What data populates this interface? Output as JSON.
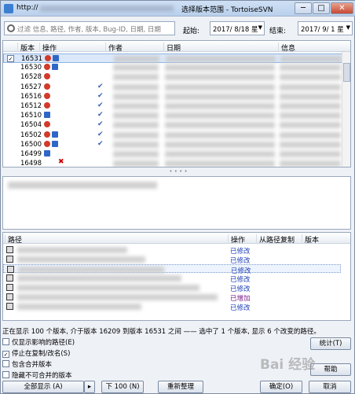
{
  "window": {
    "url_prefix": "http://",
    "title": "选择版本范围 - TortoiseSVN",
    "minimize": "─",
    "maximize": "□",
    "close": "✕"
  },
  "filter": {
    "placeholder": "过滤 信息, 路径, 作者, 版本, Bug-ID, 日期, 日期",
    "from_label": "起始:",
    "from_value": "2017/ 8/18 星",
    "to_label": "结束:",
    "to_value": "2017/ 9/ 1 星"
  },
  "log_columns": {
    "revision": "版本",
    "actions": "操作",
    "author": "作者",
    "date": "日期",
    "message": "信息"
  },
  "revisions": [
    "16531",
    "16530",
    "16528",
    "16527",
    "16516",
    "16512",
    "16510",
    "16504",
    "16502",
    "16500",
    "16499",
    "16498"
  ],
  "path_columns": {
    "path": "路径",
    "action": "操作",
    "copied_from": "从路径复制",
    "revision": "版本"
  },
  "path_actions": [
    "已修改",
    "已修改",
    "已修改",
    "已修改",
    "已修改",
    "已增加",
    "已修改"
  ],
  "status_text": "正在显示 100 个版本, 介于版本 16209 到版本 16531 之间 —— 选中了 1 个版本, 显示 6 个改变的路径。",
  "options": {
    "show_affected": "仅显示影响的路径(E)",
    "stop_on_copy": "停止在复制/改名(S)",
    "include_merged": "包含合并版本",
    "hide_unrelated": "隐藏不可合并的版本"
  },
  "buttons": {
    "show_all": "全部显示 (A)",
    "next_100": "下 100 (N)",
    "refresh": "重新整理",
    "statistics": "统计(T)",
    "help": "帮助",
    "ok": "确定(O)",
    "cancel": "取消"
  },
  "watermark": "Bai 经验"
}
